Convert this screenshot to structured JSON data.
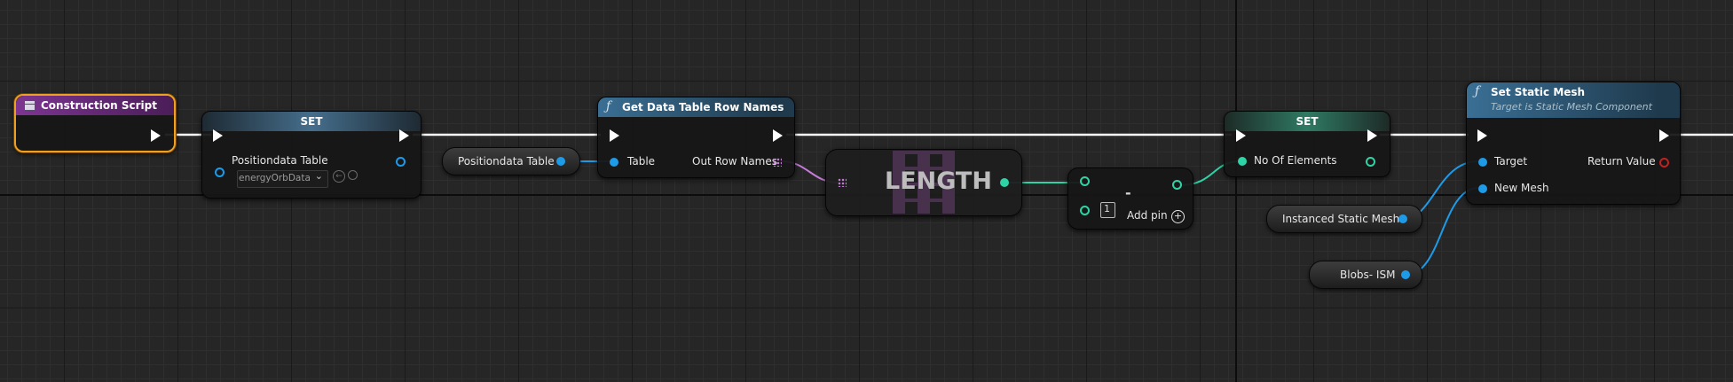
{
  "nodes": {
    "construction_script": {
      "title": "Construction Script"
    },
    "set_table": {
      "title": "SET",
      "input_label": "Positiondata Table",
      "asset_value": "energyOrbData"
    },
    "var_positiondata": {
      "label": "Positiondata Table"
    },
    "get_row_names": {
      "title": "Get Data Table Row Names",
      "in_label": "Table",
      "out_label": "Out Row Names"
    },
    "length": {
      "label": "LENGTH"
    },
    "subtract": {
      "symbol": "-",
      "default_value": "1",
      "add_pin": "Add pin"
    },
    "set_elements": {
      "title": "SET",
      "input_label": "No Of Elements"
    },
    "set_static_mesh": {
      "title": "Set Static Mesh",
      "subtitle": "Target is Static Mesh Component",
      "target_label": "Target",
      "new_mesh_label": "New Mesh",
      "return_label": "Return Value"
    },
    "var_ism": {
      "label": "Instanced Static Mesh"
    },
    "var_blobs": {
      "label": "Blobs- ISM"
    }
  },
  "colors": {
    "exec": "#ffffff",
    "object": "#1e9be8",
    "integer": "#2dd4a6",
    "array_name": "#c67bd8",
    "selection": "#f0a020",
    "event_header": "#6e2d7e",
    "function_header": "#2d5f80",
    "set_header": "#3e6680",
    "set_int_header": "#2e6f5a"
  },
  "icons": [
    "event-icon",
    "function-icon",
    "dropdown-chevron-icon",
    "browse-arrow-icon",
    "search-icon",
    "add-pin-icon"
  ]
}
